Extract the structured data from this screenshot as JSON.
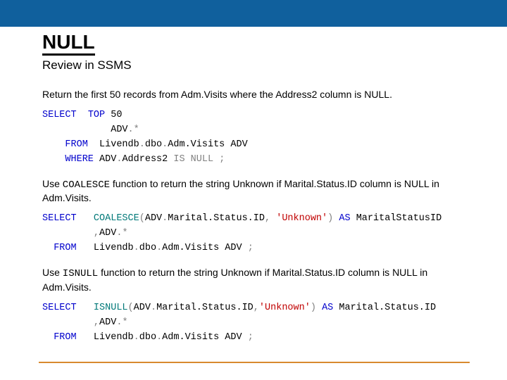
{
  "header": {
    "title": "NULL",
    "subtitle": "Review in SSMS"
  },
  "sections": [
    {
      "instruction": "Return the first 50 records from Adm.Visits where the Address2 column is NULL."
    },
    {
      "instruction_pre": "Use ",
      "func": "COALESCE",
      "instruction_post": " function to return the string Unknown if Marital.Status.ID column is NULL in Adm.Visits."
    },
    {
      "instruction_pre": "Use ",
      "func": "ISNULL",
      "instruction_post": " function to return the string Unknown if Marital.Status.ID column is NULL in Adm.Visits."
    }
  ],
  "sql": {
    "q1": {
      "select": "SELECT",
      "top": "TOP",
      "topn": "50",
      "alias": "ADV",
      "dot": ".",
      "star": "*",
      "from": "FROM",
      "db": "Livendb",
      "schema": "dbo",
      "table": "Adm.Visits",
      "where": "WHERE",
      "col": "Address2",
      "isnull": "IS NULL",
      "semi": ";"
    },
    "q2": {
      "select": "SELECT",
      "fn": "COALESCE",
      "lp": "(",
      "rp": ")",
      "alias": "ADV",
      "dot": ".",
      "col": "Marital.Status.ID",
      "comma": ",",
      "quote": "'",
      "unk": "Unknown",
      "as": "AS",
      "ascol": "MaritalStatusID",
      "star": "*",
      "from": "FROM",
      "db": "Livendb",
      "schema": "dbo",
      "table": "Adm.Visits",
      "semi": ";"
    },
    "q3": {
      "select": "SELECT",
      "fn": "ISNULL",
      "lp": "(",
      "rp": ")",
      "alias": "ADV",
      "dot": ".",
      "col": "Marital.Status.ID",
      "comma": ",",
      "quote": "'",
      "unk": "Unknown",
      "as": "AS",
      "ascol": "Marital.Status.ID",
      "star": "*",
      "from": "FROM",
      "db": "Livendb",
      "schema": "dbo",
      "table": "Adm.Visits",
      "semi": ";"
    }
  }
}
